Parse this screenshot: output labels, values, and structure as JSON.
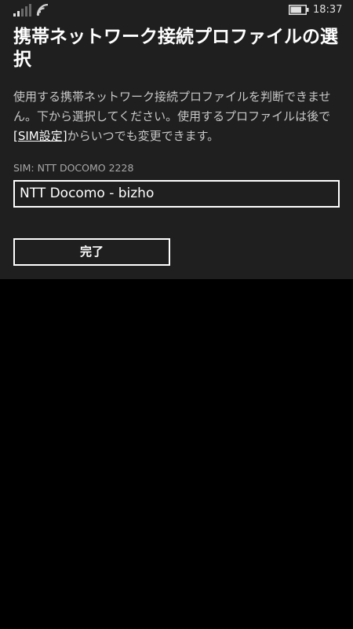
{
  "status_bar": {
    "time": "18:37",
    "signal_icon": "signal-bars-icon",
    "wifi_icon": "wifi-icon",
    "battery_icon": "battery-icon",
    "signal_strength": 0.4,
    "battery_level": 0.75
  },
  "dialog": {
    "title": "携帯ネットワーク接続プロファイルの選択",
    "message_before_link": "使用する携帯ネットワーク接続プロファイルを判断できません。下から選択してください。使用するプロファイルは後で",
    "message_link": "[SIM設定]",
    "message_after_link": "からいつでも変更できます。",
    "sim_label": "SIM: NTT DOCOMO 2228",
    "selected_profile": "NTT Docomo - bizho",
    "done_label": "完了"
  },
  "colors": {
    "background": "#000000",
    "dialog_background": "#1f1f1f",
    "text_primary": "#ffffff",
    "text_secondary": "#c8c8c8",
    "label_text": "#a8a8a8"
  }
}
